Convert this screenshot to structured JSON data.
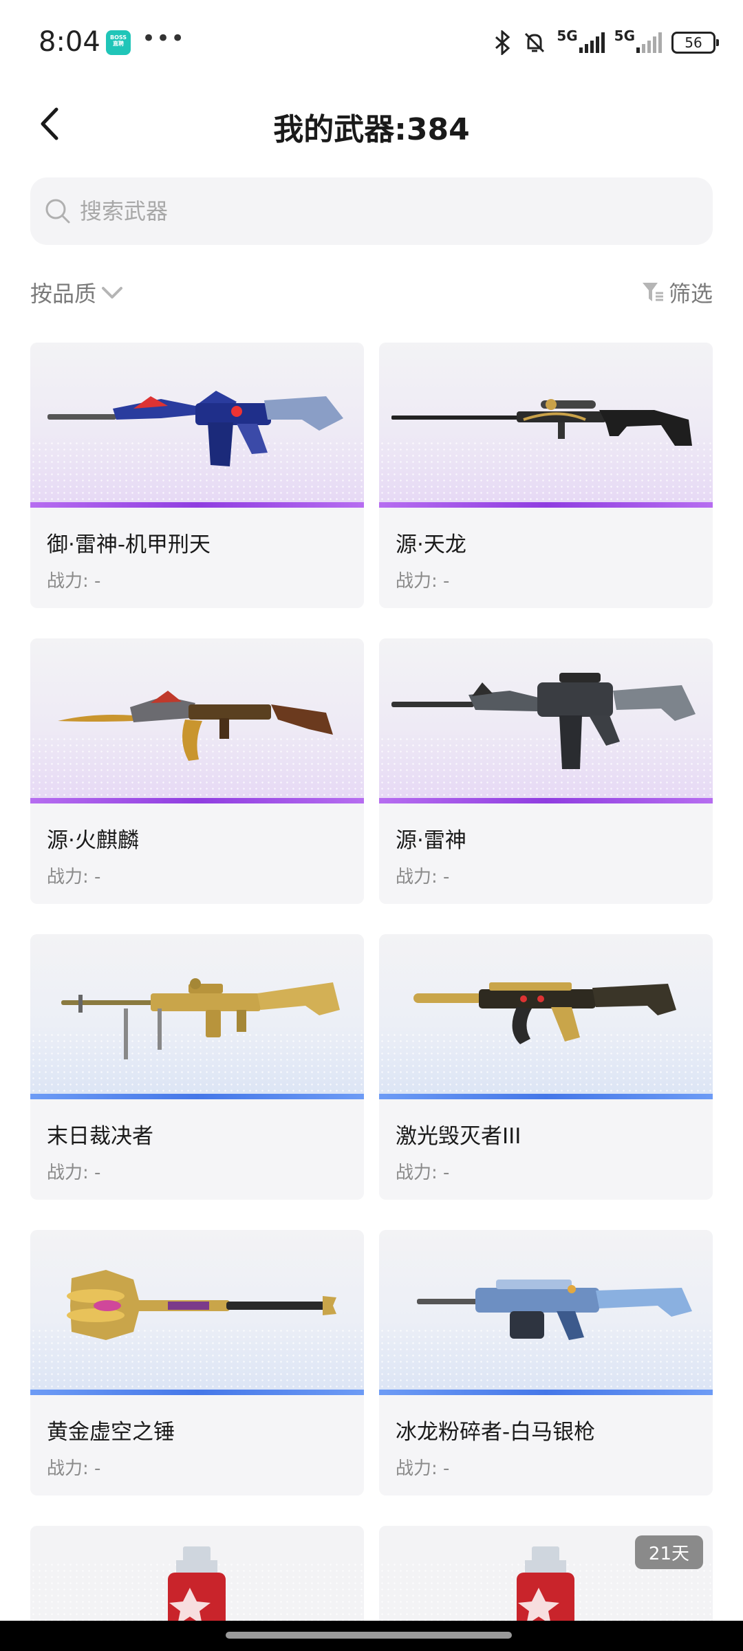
{
  "status_bar": {
    "time": "8:04",
    "app_badge": "BOSS\n直聘",
    "dots": "•••",
    "net1": "5G",
    "net2": "5G",
    "battery": "56"
  },
  "header": {
    "title": "我的武器:384"
  },
  "search": {
    "placeholder": "搜索武器"
  },
  "toolbar": {
    "sort_label": "按品质",
    "filter_label": "筛选"
  },
  "weapons": [
    {
      "name": "御·雷神-机甲刑天",
      "power": "战力: -",
      "quality": "purple",
      "icon": "rifle-icon"
    },
    {
      "name": "源·天龙",
      "power": "战力: -",
      "quality": "purple",
      "icon": "sniper-rifle-icon"
    },
    {
      "name": "源·火麒麟",
      "power": "战力: -",
      "quality": "purple",
      "icon": "ak-rifle-icon"
    },
    {
      "name": "源·雷神",
      "power": "战力: -",
      "quality": "purple",
      "icon": "rifle-icon"
    },
    {
      "name": "末日裁决者",
      "power": "战力: -",
      "quality": "blue",
      "icon": "machine-gun-icon"
    },
    {
      "name": "激光毁灭者III",
      "power": "战力: -",
      "quality": "blue",
      "icon": "gold-rifle-icon"
    },
    {
      "name": "黄金虚空之锤",
      "power": "战力: -",
      "quality": "blue",
      "icon": "hammer-icon"
    },
    {
      "name": "冰龙粉碎者-白马银枪",
      "power": "战力: -",
      "quality": "blue",
      "icon": "heavy-gun-icon"
    }
  ],
  "partial_cards": [
    {
      "icon": "grenade-icon",
      "badge": ""
    },
    {
      "icon": "grenade-icon",
      "badge": "21天"
    }
  ],
  "colors": {
    "purple_quality": "#8f3de0",
    "blue_quality": "#4577e8",
    "search_bg": "#f4f4f6"
  }
}
